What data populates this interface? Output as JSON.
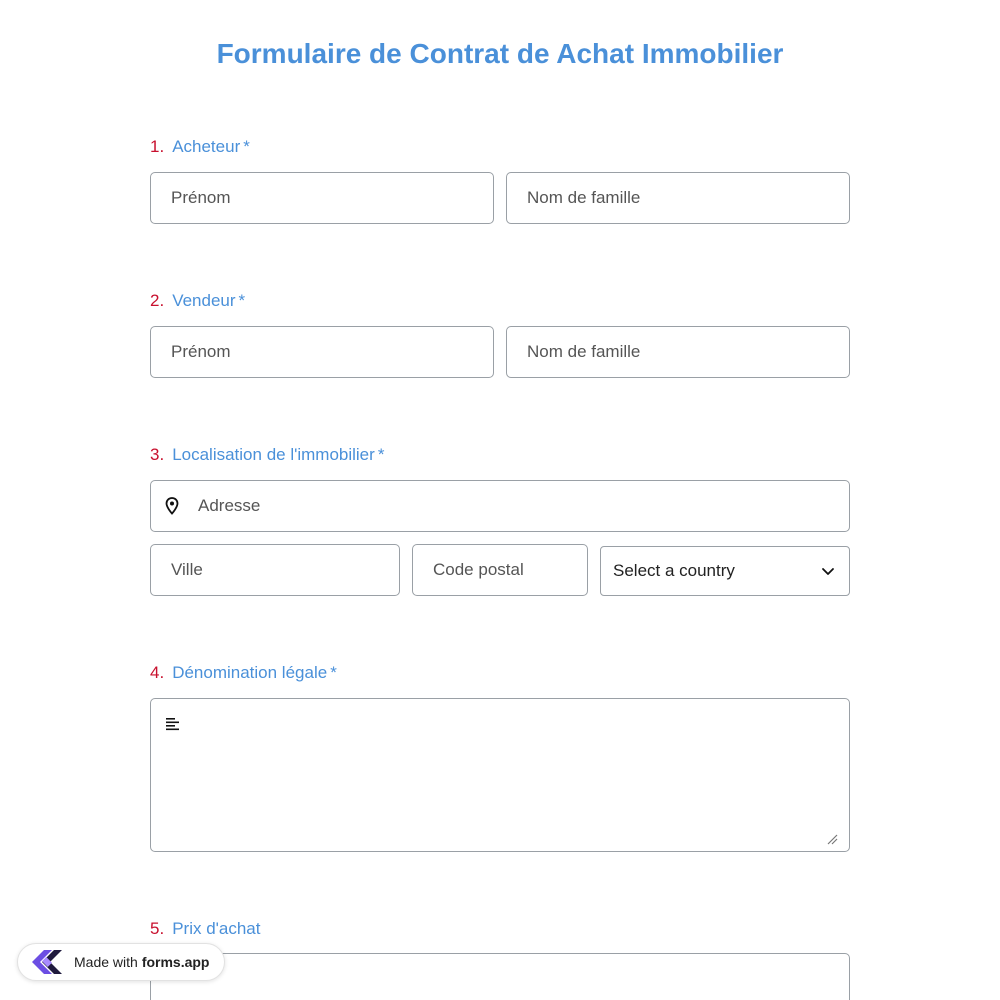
{
  "form": {
    "title": "Formulaire de Contrat de Achat Immobilier",
    "required_mark": "*"
  },
  "questions": [
    {
      "number": "1.",
      "label": "Acheteur",
      "first_name_placeholder": "Prénom",
      "last_name_placeholder": "Nom de famille"
    },
    {
      "number": "2.",
      "label": "Vendeur",
      "first_name_placeholder": "Prénom",
      "last_name_placeholder": "Nom de famille"
    },
    {
      "number": "3.",
      "label": "Localisation de l'immobilier",
      "address_placeholder": "Adresse",
      "city_placeholder": "Ville",
      "postal_placeholder": "Code postal",
      "country_value": "Select a country"
    },
    {
      "number": "4.",
      "label": "Dénomination légale"
    },
    {
      "number": "5.",
      "label": "Prix d'achat"
    }
  ],
  "badge": {
    "made_with": "Made with",
    "brand": "forms.app"
  },
  "icons": {
    "address": "map-pin-icon",
    "country_select": "chevron-down-icon",
    "textarea": "text-lines-icon",
    "price": "currency-icon",
    "badge_logo": "forms-app-logo"
  },
  "colors": {
    "accent": "#4a90d9",
    "number": "#c8102e",
    "border": "#9aa0a6"
  }
}
